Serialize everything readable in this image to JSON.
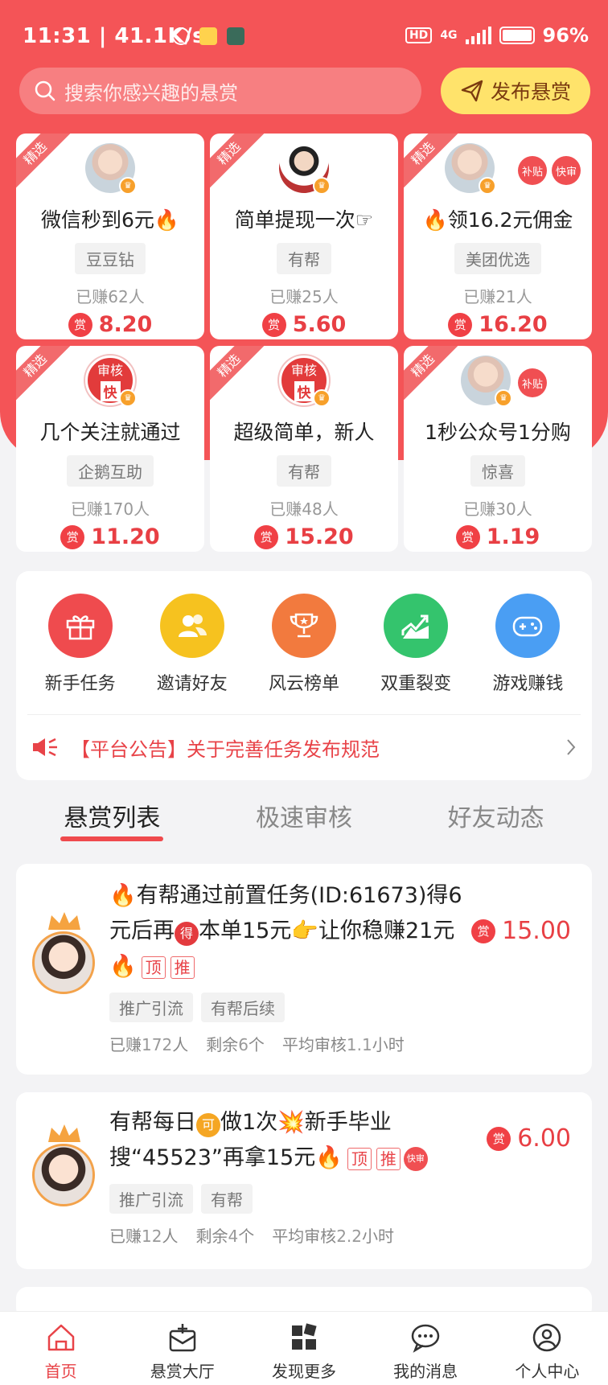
{
  "status_bar": {
    "time": "11:31 | 41.1K/s",
    "battery": "96%",
    "network": "4G",
    "hd": "HD"
  },
  "search": {
    "placeholder": "搜索你感兴趣的悬赏"
  },
  "post_button": {
    "label": "发布悬赏"
  },
  "featured_ribbon": "精选",
  "featured_cards": [
    {
      "title": "微信秒到6元🔥",
      "tag": "豆豆钻",
      "earned_prefix": "已赚",
      "earned_count": "62",
      "earned_suffix": "人",
      "price": "8.20",
      "reward_icon": "赏",
      "side_tags": []
    },
    {
      "title": "简单提现一次☞",
      "tag": "有帮",
      "earned_prefix": "已赚",
      "earned_count": "25",
      "earned_suffix": "人",
      "price": "5.60",
      "reward_icon": "赏",
      "side_tags": []
    },
    {
      "title": "🔥领16.2元佣金",
      "tag": "美团优选",
      "earned_prefix": "已赚",
      "earned_count": "21",
      "earned_suffix": "人",
      "price": "16.20",
      "reward_icon": "赏",
      "side_tags": [
        "补贴",
        "快审"
      ]
    },
    {
      "title": "几个关注就通过",
      "tag": "企鹅互助",
      "earned_prefix": "已赚",
      "earned_count": "170",
      "earned_suffix": "人",
      "price": "11.20",
      "reward_icon": "赏",
      "audit_label": "审核",
      "audit_quick": "快",
      "side_tags": []
    },
    {
      "title": "超级简单，新人",
      "tag": "有帮",
      "earned_prefix": "已赚",
      "earned_count": "48",
      "earned_suffix": "人",
      "price": "15.20",
      "reward_icon": "赏",
      "audit_label": "审核",
      "audit_quick": "快",
      "side_tags": []
    },
    {
      "title": "1秒公众号1分购",
      "tag": "惊喜",
      "earned_prefix": "已赚",
      "earned_count": "30",
      "earned_suffix": "人",
      "price": "1.19",
      "reward_icon": "赏",
      "side_tags": [
        "补贴"
      ]
    }
  ],
  "menu": {
    "items": [
      {
        "label": "新手任务",
        "color": "#ef4b4e",
        "icon": "gift-icon"
      },
      {
        "label": "邀请好友",
        "color": "#f6c21f",
        "icon": "users-icon"
      },
      {
        "label": "风云榜单",
        "color": "#f27a3e",
        "icon": "trophy-icon"
      },
      {
        "label": "双重裂变",
        "color": "#34c46d",
        "icon": "trend-chart-icon"
      },
      {
        "label": "游戏赚钱",
        "color": "#4a9ef3",
        "icon": "gamepad-icon"
      }
    ],
    "notice": "【平台公告】关于完善任务发布规范"
  },
  "tabs": [
    {
      "label": "悬赏列表",
      "active": true
    },
    {
      "label": "极速审核",
      "active": false
    },
    {
      "label": "好友动态",
      "active": false
    }
  ],
  "list": [
    {
      "title_a": "🔥有帮通过前置任务(ID:61673)得6元后再",
      "de": "得",
      "title_b": "本单15元👉让你稳赚21元🔥",
      "badge_top": "顶",
      "badge_push": "推",
      "reward_icon": "赏",
      "price": "15.00",
      "tags": [
        "推广引流",
        "有帮后续"
      ],
      "earned_prefix": "已赚",
      "earned_count": "172",
      "earned_suffix": "人",
      "remain_prefix": "剩余",
      "remain_count": "6",
      "remain_suffix": "个",
      "avg_prefix": "平均审核",
      "avg_value": "1.1",
      "avg_suffix": "小时"
    },
    {
      "title_a": "有帮每日",
      "ke": "可",
      "title_b": "做1次💥新手毕业搜“45523”再拿15元🔥",
      "badge_top": "顶",
      "badge_push": "推",
      "badge_fast": "快审",
      "reward_icon": "赏",
      "price": "6.00",
      "tags": [
        "推广引流",
        "有帮"
      ],
      "earned_prefix": "已赚",
      "earned_count": "12",
      "earned_suffix": "人",
      "remain_prefix": "剩余",
      "remain_count": "4",
      "remain_suffix": "个",
      "avg_prefix": "平均审核",
      "avg_value": "2.2",
      "avg_suffix": "小时"
    }
  ],
  "bottom_nav": [
    {
      "label": "首页",
      "active": true,
      "icon": "home-icon"
    },
    {
      "label": "悬赏大厅",
      "active": false,
      "icon": "reward-hall-icon"
    },
    {
      "label": "发现更多",
      "active": false,
      "icon": "discover-icon"
    },
    {
      "label": "我的消息",
      "active": false,
      "icon": "message-icon"
    },
    {
      "label": "个人中心",
      "active": false,
      "icon": "profile-icon"
    }
  ],
  "colors": {
    "brand_red": "#f45457",
    "price_red": "#e83f44",
    "post_button_yellow": "#ffe36b"
  }
}
